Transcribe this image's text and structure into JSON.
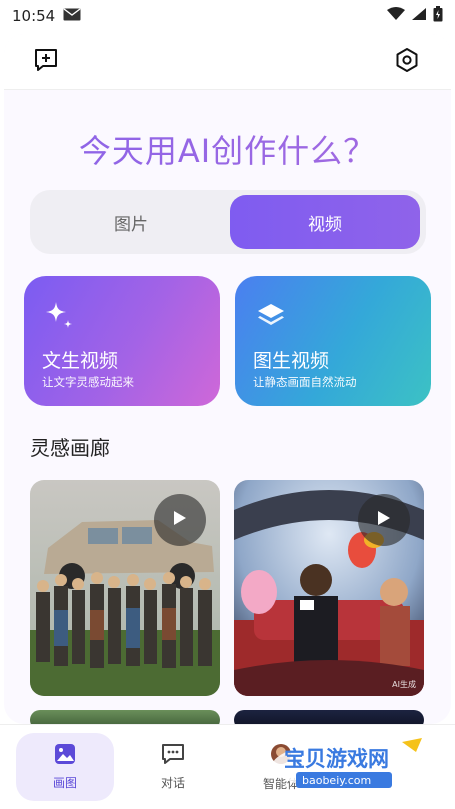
{
  "status_bar": {
    "time": "10:54"
  },
  "header": {
    "new_chat_icon": "chat-plus-icon",
    "settings_icon": "hexagon-settings-icon"
  },
  "headline": "今天用AI创作什么？",
  "segment": {
    "items": [
      {
        "label": "图片",
        "active": false
      },
      {
        "label": "视频",
        "active": true
      }
    ]
  },
  "features": [
    {
      "title": "文生视频",
      "subtitle": "让文字灵感动起来",
      "icon": "sparkle-icon"
    },
    {
      "title": "图生视频",
      "subtitle": "让静态画面自然流动",
      "icon": "layers-icon"
    }
  ],
  "gallery": {
    "title": "灵感画廊",
    "ai_tag": "AI生成"
  },
  "bottom_nav": {
    "items": [
      {
        "label": "画图",
        "icon": "image-icon",
        "active": true
      },
      {
        "label": "对话",
        "icon": "chat-icon",
        "active": false
      },
      {
        "label": "智能体",
        "icon": "agent-icon",
        "active": false
      }
    ]
  },
  "watermark": {
    "text": "宝贝游戏网",
    "url": "baobeiy.com"
  },
  "colors": {
    "accent": "#7f5cf0",
    "nav_active_bg": "#eeeafc"
  }
}
